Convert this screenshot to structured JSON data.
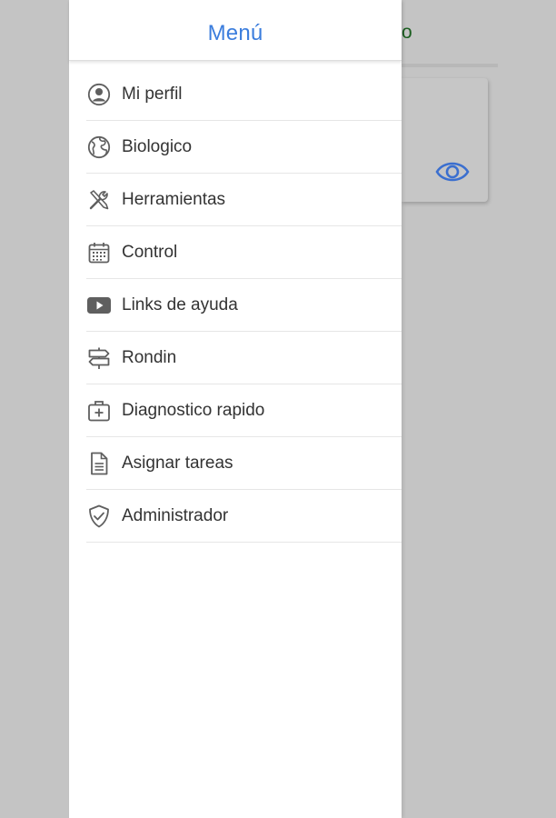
{
  "background_app": {
    "header_fragment": "o",
    "card_icon": "eye-icon"
  },
  "drawer": {
    "title": "Menú",
    "items": [
      {
        "label": "Mi perfil",
        "icon": "user-circle-icon"
      },
      {
        "label": "Biologico",
        "icon": "globe-icon"
      },
      {
        "label": "Herramientas",
        "icon": "tools-icon"
      },
      {
        "label": "Control",
        "icon": "calendar-icon"
      },
      {
        "label": "Links de ayuda",
        "icon": "video-play-icon"
      },
      {
        "label": "Rondin",
        "icon": "signpost-icon"
      },
      {
        "label": "Diagnostico rapido",
        "icon": "medical-kit-icon"
      },
      {
        "label": "Asignar tareas",
        "icon": "document-icon"
      },
      {
        "label": "Administrador",
        "icon": "shield-check-icon"
      }
    ]
  },
  "colors": {
    "title_accent": "#3b7ddd",
    "icon_gray": "#5f5f5f",
    "overlay": "#c4c4c4",
    "bg_header_green": "#1b5e20",
    "eye_blue": "#3b6fcf"
  }
}
